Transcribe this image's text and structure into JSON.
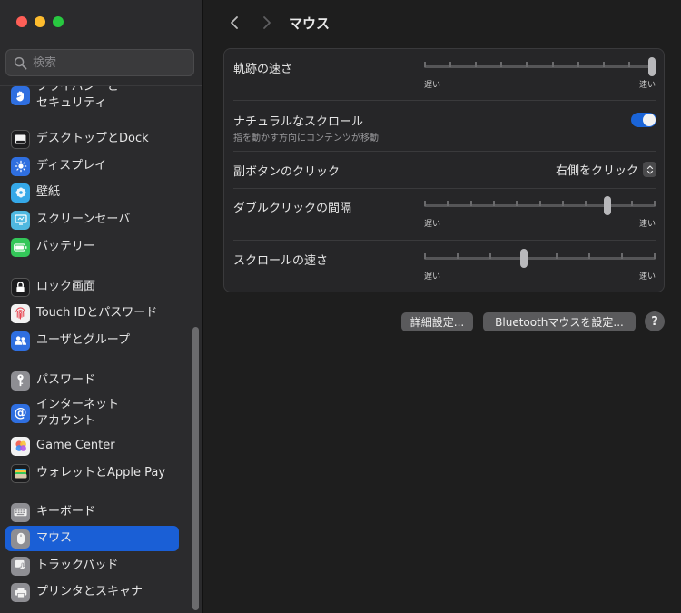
{
  "window": {
    "title": "マウス",
    "traffic_lights": {
      "close": "#ff5f57",
      "minimize": "#febc2e",
      "zoom": "#28c840"
    }
  },
  "sidebar": {
    "search_placeholder": "検索",
    "items": [
      {
        "id": "privacy",
        "label": "プライバシーと\nセキュリティ",
        "icon": "hand-icon",
        "color": "#2f6fe0"
      },
      {
        "id": "desktop-dock",
        "label": "デスクトップとDock",
        "icon": "dock-icon",
        "color": "#1c1c1e"
      },
      {
        "id": "displays",
        "label": "ディスプレイ",
        "icon": "sun-icon",
        "color": "#2f6fe0"
      },
      {
        "id": "wallpaper",
        "label": "壁紙",
        "icon": "flower-icon",
        "color": "#35a8e8"
      },
      {
        "id": "screensaver",
        "label": "スクリーンセーバ",
        "icon": "screensaver-icon",
        "color": "#4fb8e0"
      },
      {
        "id": "battery",
        "label": "バッテリー",
        "icon": "battery-icon",
        "color": "#34c759"
      },
      {
        "id": "lock-screen",
        "label": "ロック画面",
        "icon": "lock-icon",
        "color": "#1c1c1e"
      },
      {
        "id": "touch-id",
        "label": "Touch IDとパスワード",
        "icon": "fingerprint-icon",
        "color": "#f2f2f2"
      },
      {
        "id": "users-groups",
        "label": "ユーザとグループ",
        "icon": "users-icon",
        "color": "#2f6fe0"
      },
      {
        "id": "passwords",
        "label": "パスワード",
        "icon": "key-icon",
        "color": "#8e8e93"
      },
      {
        "id": "internet-accounts",
        "label": "インターネット\nアカウント",
        "icon": "at-icon",
        "color": "#2f6fe0"
      },
      {
        "id": "game-center",
        "label": "Game Center",
        "icon": "game-center-icon",
        "color": "#f2f2f2"
      },
      {
        "id": "wallet",
        "label": "ウォレットとApple Pay",
        "icon": "wallet-icon",
        "color": "#1c1c1e"
      },
      {
        "id": "keyboard",
        "label": "キーボード",
        "icon": "keyboard-icon",
        "color": "#8e8e93"
      },
      {
        "id": "mouse",
        "label": "マウス",
        "icon": "mouse-icon",
        "color": "#8e8e93",
        "active": true
      },
      {
        "id": "trackpad",
        "label": "トラックパッド",
        "icon": "trackpad-icon",
        "color": "#8e8e93"
      },
      {
        "id": "printers",
        "label": "プリンタとスキャナ",
        "icon": "printer-icon",
        "color": "#8e8e93"
      }
    ]
  },
  "main": {
    "settings": {
      "tracking_speed": {
        "label": "軌跡の速さ",
        "min_label": "遅い",
        "max_label": "速い",
        "value": 1.0
      },
      "natural_scroll": {
        "label": "ナチュラルなスクロール",
        "sublabel": "指を動かす方向にコンテンツが移動",
        "enabled": true
      },
      "secondary_click": {
        "label": "副ボタンのクリック",
        "value": "右側をクリック"
      },
      "double_click": {
        "label": "ダブルクリックの間隔",
        "min_label": "遅い",
        "max_label": "速い",
        "value": 0.8
      },
      "scroll_speed": {
        "label": "スクロールの速さ",
        "min_label": "遅い",
        "max_label": "速い",
        "value": 0.43
      }
    },
    "buttons": {
      "advanced": "詳細設定...",
      "bluetooth": "Bluetoothマウスを設定...",
      "help": "?"
    }
  }
}
